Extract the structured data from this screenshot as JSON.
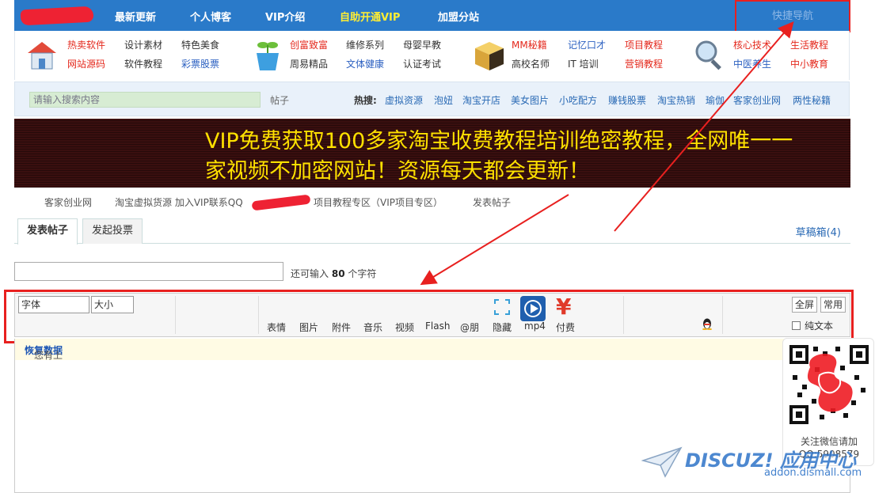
{
  "nav": {
    "items": [
      "最新更新",
      "个人博客",
      "VIP介绍",
      "自助开通VIP",
      "加盟分站"
    ],
    "quick_nav": "快捷导航"
  },
  "categories": {
    "g1": [
      "热卖软件",
      "设计素材",
      "特色美食",
      "网站源码",
      "软件教程",
      "彩票股票"
    ],
    "g2": [
      "创富致富",
      "维修系列",
      "母婴早教",
      "周易精品",
      "文体健康",
      "认证考试"
    ],
    "g3": [
      "MM秘籍",
      "记忆口才",
      "项目教程",
      "高校名师",
      "IT 培训",
      "营销教程"
    ],
    "g4": [
      "核心技术",
      "生活教程",
      "中医养生",
      "中小教育"
    ]
  },
  "search": {
    "placeholder": "请输入搜索内容",
    "scope": "帖子",
    "hot_label": "热搜:",
    "hot": [
      "虚拟资源",
      "泡妞",
      "淘宝开店",
      "美女图片",
      "小吃配方",
      "赚钱股票",
      "淘宝热销",
      "瑜伽",
      "客家创业网",
      "两性秘籍"
    ]
  },
  "banner": {
    "line1": "VIP免费获取100多家淘宝收费教程培训绝密教程，全网唯一一",
    "line2": "家视频不加密网站！资源每天都会更新！"
  },
  "breadcrumb": {
    "site": "客家创业网",
    "forum": "淘宝虚拟货源 加入VIP联系QQ",
    "section": "项目教程专区（VIP项目专区）",
    "current": "发表帖子"
  },
  "tabs": {
    "post": "发表帖子",
    "poll": "发起投票",
    "drafts": "草稿箱(4)"
  },
  "subject": {
    "hint_pre": "还可输入",
    "count": "80",
    "hint_post": "个字符"
  },
  "toolbar": {
    "font": "字体",
    "size": "大小",
    "buttons": [
      "表情",
      "图片",
      "附件",
      "音乐",
      "视频",
      "Flash",
      "@朋",
      "隐藏",
      "mp4",
      "付费"
    ],
    "fullscreen": "全屏",
    "common": "常用",
    "plain_text": "纯文本"
  },
  "restore": {
    "text": "您有上次未提交成功的数据",
    "link": "恢复数据"
  },
  "qr": {
    "line1": "关注微信请加",
    "line2": "QQ:5908579"
  },
  "watermark": {
    "brand": "DISCUZ! 应用中心",
    "url": "addon.dismall.com"
  },
  "colors": {
    "nav_bg": "#2a7ac9",
    "highlight": "#e8201f",
    "banner_text": "#ffe100"
  }
}
